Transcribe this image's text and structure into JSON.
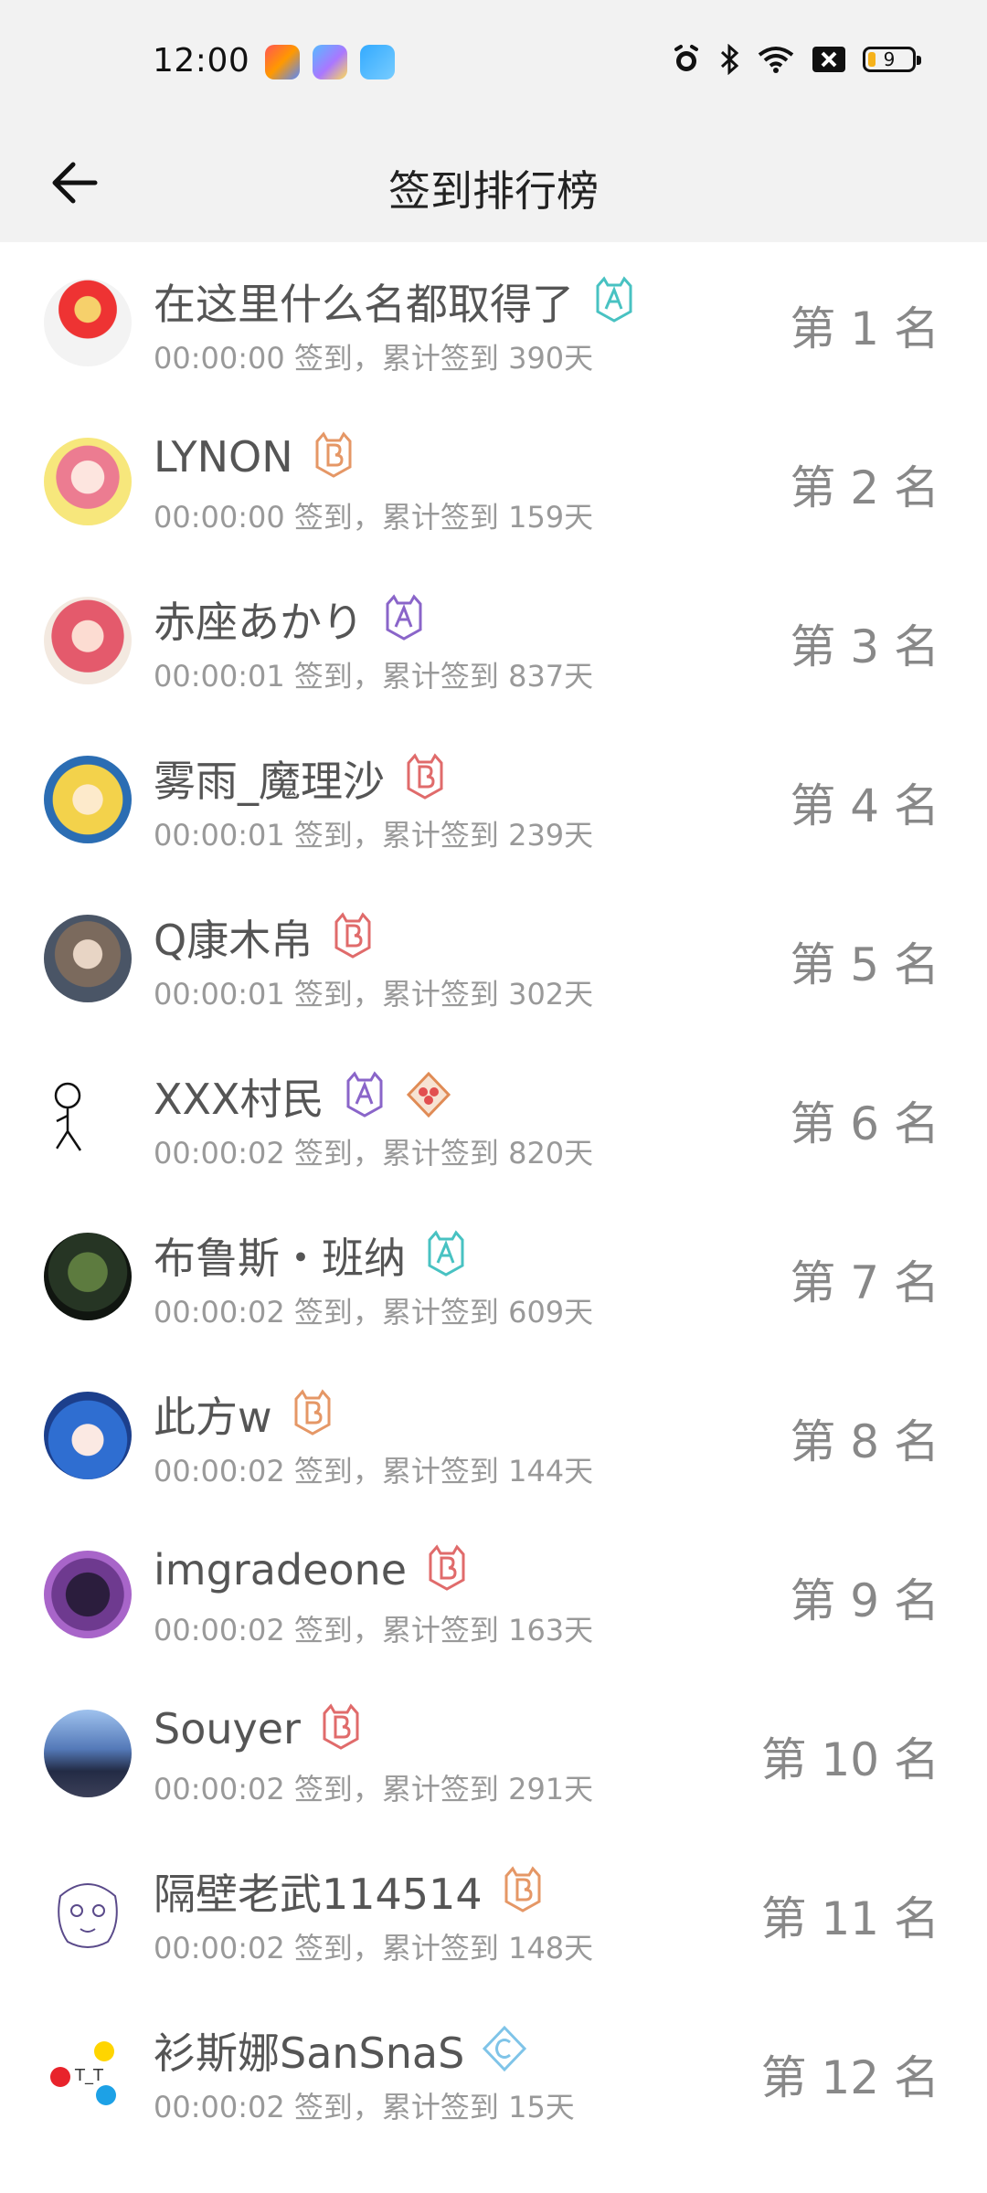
{
  "status_bar": {
    "time": "12:00",
    "battery_level": "9",
    "icons": [
      "alarm-icon",
      "bluetooth-icon",
      "wifi-icon",
      "sim-off-icon",
      "battery-icon"
    ],
    "app_icons": [
      "notification-app-1",
      "notification-app-2",
      "notification-app-3"
    ]
  },
  "header": {
    "title": "签到排行榜",
    "back_icon": "arrow-left-icon"
  },
  "users": [
    {
      "name": "在这里什么名都取得了",
      "time": "00:00:00",
      "days": "390",
      "rank": "1",
      "badges": [
        {
          "icon": "level-a-badge",
          "color": "#48c2c2"
        }
      ]
    },
    {
      "name": "LYNON",
      "time": "00:00:00",
      "days": "159",
      "rank": "2",
      "badges": [
        {
          "icon": "level-b-badge",
          "color": "#e59766"
        }
      ]
    },
    {
      "name": "赤座あかり",
      "time": "00:00:01",
      "days": "837",
      "rank": "3",
      "badges": [
        {
          "icon": "level-a-badge",
          "color": "#8a65c9"
        }
      ]
    },
    {
      "name": "雾雨_魔理沙",
      "time": "00:00:01",
      "days": "239",
      "rank": "4",
      "badges": [
        {
          "icon": "level-b-badge",
          "color": "#e06b6b"
        }
      ]
    },
    {
      "name": "Q康木帛",
      "time": "00:00:01",
      "days": "302",
      "rank": "5",
      "badges": [
        {
          "icon": "level-b-badge",
          "color": "#e06b6b"
        }
      ]
    },
    {
      "name": "XXX村民",
      "time": "00:00:02",
      "days": "820",
      "rank": "6",
      "badges": [
        {
          "icon": "level-a-badge",
          "color": "#8a65c9"
        },
        {
          "icon": "flower-badge",
          "color": "#e08b55"
        }
      ]
    },
    {
      "name": "布鲁斯・班纳",
      "time": "00:00:02",
      "days": "609",
      "rank": "7",
      "badges": [
        {
          "icon": "level-a-badge",
          "color": "#48c2c2"
        }
      ]
    },
    {
      "name": "此方w",
      "time": "00:00:02",
      "days": "144",
      "rank": "8",
      "badges": [
        {
          "icon": "level-b-badge",
          "color": "#e59766"
        }
      ]
    },
    {
      "name": "imgradeone",
      "time": "00:00:02",
      "days": "163",
      "rank": "9",
      "badges": [
        {
          "icon": "level-b-badge",
          "color": "#e06b6b"
        }
      ]
    },
    {
      "name": "Souyer",
      "time": "00:00:02",
      "days": "291",
      "rank": "10",
      "badges": [
        {
          "icon": "level-b-badge",
          "color": "#e06b6b"
        }
      ]
    },
    {
      "name": "隔壁老武114514",
      "time": "00:00:02",
      "days": "148",
      "rank": "11",
      "badges": [
        {
          "icon": "level-b-badge",
          "color": "#e59766"
        }
      ]
    },
    {
      "name": "衫斯娜SanSnaS",
      "time": "00:00:02",
      "days": "15",
      "rank": "12",
      "badges": [
        {
          "icon": "level-c-badge",
          "color": "#7fc4e8"
        }
      ]
    }
  ],
  "text": {
    "checkin_suffix": "签到，累计签到",
    "days_unit": "天",
    "rank_prefix": "第",
    "rank_suffix": "名"
  }
}
